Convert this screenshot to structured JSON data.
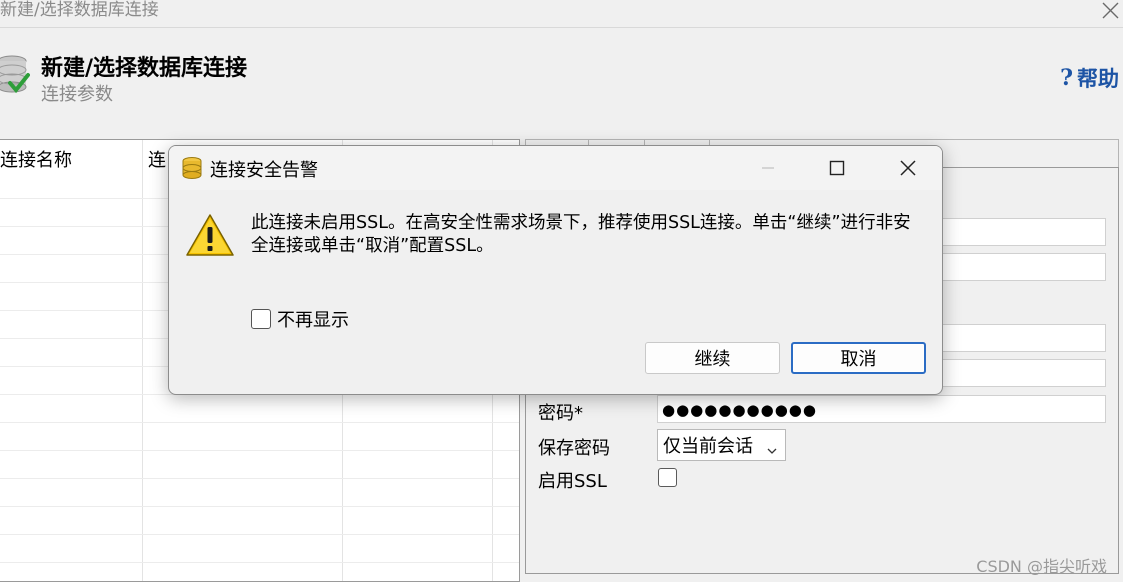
{
  "window": {
    "title": "新建/选择数据库连接",
    "close_icon": "close-icon"
  },
  "header": {
    "title": "新建/选择数据库连接",
    "subtitle": "连接参数",
    "help_label": "帮助",
    "help_icon_glyph": "?",
    "icon": "database-check-icon"
  },
  "connection_table": {
    "columns": [
      "连接名称",
      "连"
    ]
  },
  "settings": {
    "password_label": "密码*",
    "password_value": "●●●●●●●●●●●",
    "save_password_label": "保存密码",
    "save_password_value": "仅当前会话",
    "enable_ssl_label": "启用SSL",
    "enable_ssl_checked": false
  },
  "dialog": {
    "title": "连接安全告警",
    "message": "此连接未启用SSL。在高安全性需求场景下，推荐使用SSL连接。单击“继续”进行非安全连接或单击“取消”配置SSL。",
    "dont_show_label": "不再显示",
    "dont_show_checked": false,
    "continue_label": "继续",
    "cancel_label": "取消",
    "icon": "warning-icon"
  },
  "watermark": "CSDN @指尖听戏",
  "colors": {
    "accent": "#1d54a5",
    "focus_border": "#2b6cc4",
    "background": "#f0f0f0",
    "warning_yellow": "#f7c300"
  }
}
